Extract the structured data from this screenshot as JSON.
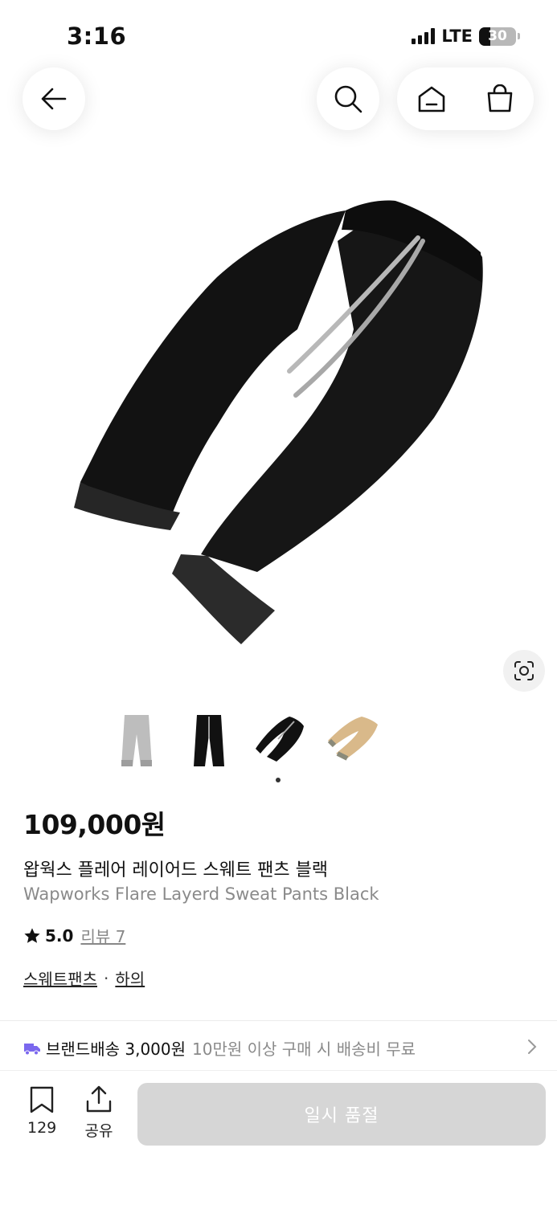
{
  "status_bar": {
    "time": "3:16",
    "network": "LTE",
    "battery": "30",
    "battery_level": 0.3
  },
  "header": {
    "back": "arrow-left-icon",
    "search": "search-icon",
    "home": "home-icon",
    "cart": "shopping-bag-icon"
  },
  "gallery": {
    "thumbnail_count": 4,
    "active_index": 2
  },
  "product": {
    "price": "109,000원",
    "name_ko": "왑웍스 플레어 레이어드 스웨트 팬츠 블랙",
    "name_en": "Wapworks Flare Layerd Sweat Pants Black",
    "rating": "5.0",
    "review_link": "리뷰 7",
    "categories": [
      "스웨트팬츠",
      "하의"
    ],
    "category_separator": "·"
  },
  "shipping": {
    "label": "브랜드배송 3,000원",
    "note": "10만원 이상 구매 시 배송비 무료"
  },
  "bottom_bar": {
    "likes": "129",
    "share": "공유",
    "action": "일시 품절"
  },
  "colors": {
    "accent_truck": "#7b68ee",
    "sold_out_bg": "#d6d6d6"
  }
}
